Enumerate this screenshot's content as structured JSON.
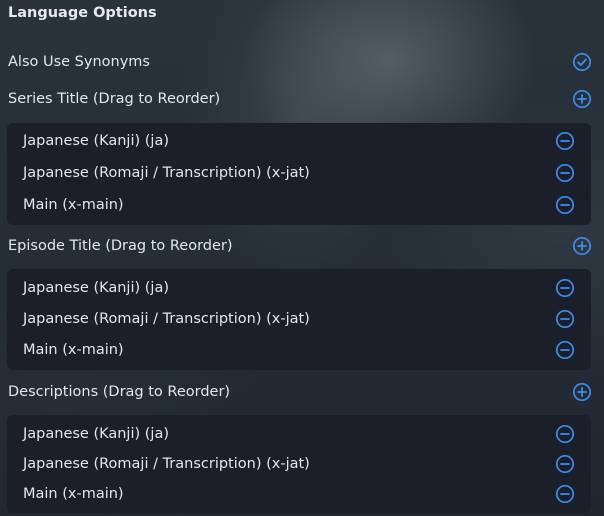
{
  "title": "Language Options",
  "colors": {
    "accent": "#3d8ef0",
    "panel": "#1b1f29",
    "text": "#e3e6ee"
  },
  "synonyms": {
    "label": "Also Use Synonyms",
    "checked": true,
    "icon": "check-circle-icon"
  },
  "sections": [
    {
      "label": "Series Title (Drag to Reorder)",
      "add_icon": "plus-circle-icon",
      "items": [
        {
          "label": "Japanese (Kanji) (ja)",
          "icon": "minus-circle-icon"
        },
        {
          "label": "Japanese (Romaji / Transcription) (x-jat)",
          "icon": "minus-circle-icon"
        },
        {
          "label": "Main (x-main)",
          "icon": "minus-circle-icon"
        }
      ]
    },
    {
      "label": "Episode Title (Drag to Reorder)",
      "add_icon": "plus-circle-icon",
      "items": [
        {
          "label": "Japanese (Kanji) (ja)",
          "icon": "minus-circle-icon"
        },
        {
          "label": "Japanese (Romaji / Transcription) (x-jat)",
          "icon": "minus-circle-icon"
        },
        {
          "label": "Main (x-main)",
          "icon": "minus-circle-icon"
        }
      ]
    },
    {
      "label": "Descriptions (Drag to Reorder)",
      "add_icon": "plus-circle-icon",
      "items": [
        {
          "label": "Japanese (Kanji) (ja)",
          "icon": "minus-circle-icon"
        },
        {
          "label": "Japanese (Romaji / Transcription) (x-jat)",
          "icon": "minus-circle-icon"
        },
        {
          "label": "Main (x-main)",
          "icon": "minus-circle-icon"
        }
      ]
    }
  ]
}
